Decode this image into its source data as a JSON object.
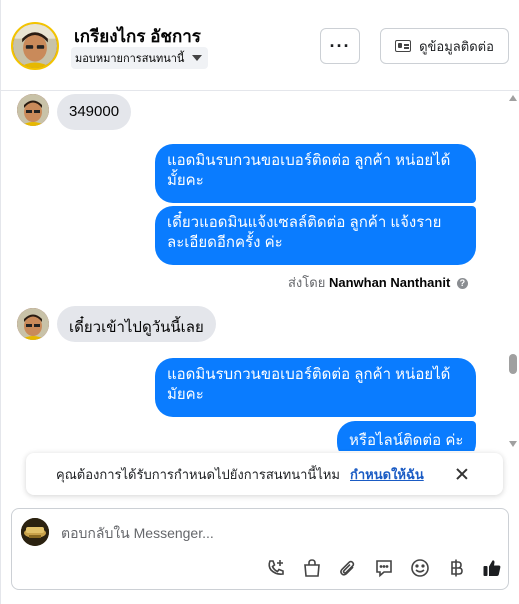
{
  "header": {
    "contact_name": "เกรียงไกร อัชการ",
    "assign_label": "มอบหมายการสนทนานี้",
    "more_label": "···",
    "contact_info_label": "ดูข้อมูลติดต่อ"
  },
  "messages": [
    {
      "direction": "in",
      "text": "349000"
    },
    {
      "direction": "out",
      "lines": [
        "แอดมินรบกวนขอเบอร์ติดต่อ ลูกค้า  หน่อยได้",
        "มั้ยคะ"
      ]
    },
    {
      "direction": "out",
      "lines": [
        "เดี๋ยวแอดมินแจ้งเซลล์ติดต่อ ลูกค้า  แจ้งราย",
        "ละเอียดอีกครั้ง ค่ะ"
      ]
    },
    {
      "direction": "in",
      "text": "เดี๋ยวเข้าไปดูวันนี้เลย"
    },
    {
      "direction": "out",
      "lines": [
        "แอดมินรบกวนขอเบอร์ติดต่อ ลูกค้า หน่อยได้",
        "มัยคะ"
      ]
    },
    {
      "direction": "out",
      "lines": [
        "หรือไลน์ติดต่อ ค่ะ"
      ]
    }
  ],
  "sent_by": {
    "prefix": "ส่งโดย",
    "name": "Nanwhan Nanthanit",
    "help": "?"
  },
  "notice": {
    "text": "คุณต้องการได้รับการกำหนดไปยังการสนทนานี้ไหม",
    "link": "กำหนดให้ฉัน"
  },
  "composer": {
    "placeholder": "ตอบกลับใน Messenger...",
    "tools": [
      "phone-plus-icon",
      "shopping-bag-icon",
      "paperclip-icon",
      "saved-reply-icon",
      "emoji-icon",
      "baht-icon",
      "thumbs-up-icon"
    ]
  },
  "colors": {
    "outgoing_bubble": "#0a7cff",
    "incoming_bubble": "#e4e6eb",
    "link": "#1a5bc4",
    "like": "#1c1e21"
  }
}
